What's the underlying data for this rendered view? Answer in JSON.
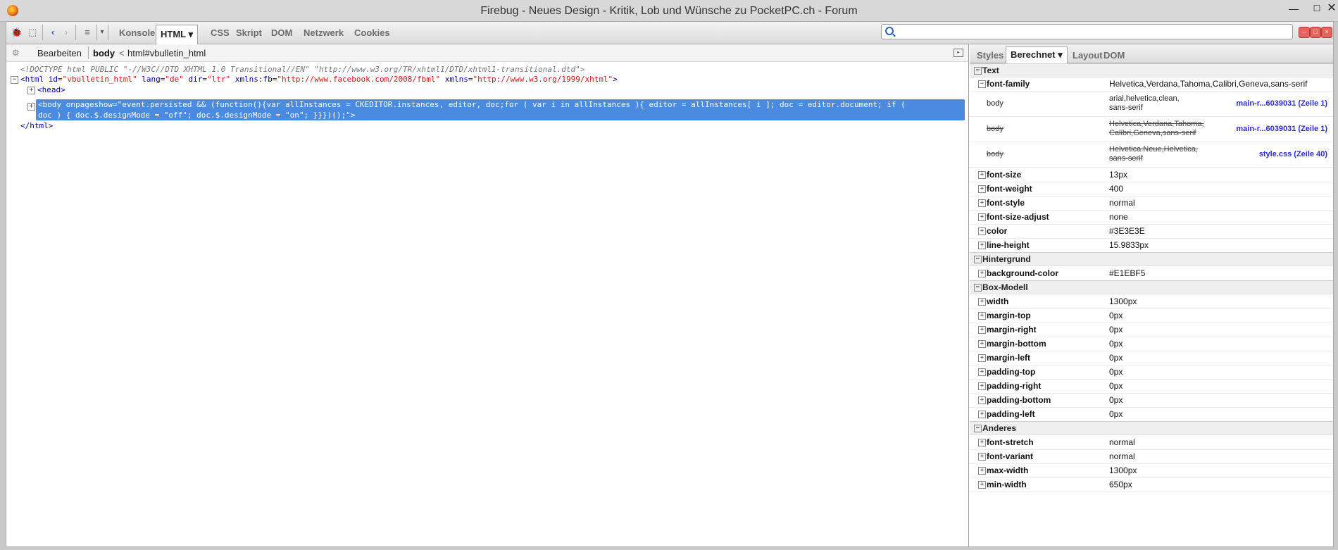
{
  "window": {
    "title": "Firebug - Neues Design - Kritik, Lob und Wünsche zu PocketPC.ch - Forum",
    "min_glyph": "—",
    "max_glyph": "☐",
    "close_glyph": "✕"
  },
  "toolbar": {
    "tabs": [
      "Konsole",
      "HTML",
      "CSS",
      "Skript",
      "DOM",
      "Netzwerk",
      "Cookies"
    ],
    "active_tab": "HTML",
    "dropdown_glyph": "▾",
    "search_placeholder": ""
  },
  "breadcrumb": {
    "edit": "Bearbeiten",
    "current": "body",
    "separator": "<",
    "parent": "html#vbulletin_html"
  },
  "html_tree": {
    "doctype": "<!DOCTYPE html PUBLIC \"-//W3C//DTD XHTML 1.0 Transitional//EN\" \"http://www.w3.org/TR/xhtml1/DTD/xhtml1-transitional.dtd\">",
    "html_open_start": "<html",
    "html_attrs": [
      {
        "name": "id",
        "value": "\"vbulletin_html\""
      },
      {
        "name": "lang",
        "value": "\"de\""
      },
      {
        "name": "dir",
        "value": "\"ltr\""
      },
      {
        "name": "xmlns:fb",
        "value": "\"http://www.facebook.com/2008/fbml\""
      },
      {
        "name": "xmlns",
        "value": "\"http://www.w3.org/1999/xhtml\""
      }
    ],
    "html_open_end": ">",
    "head": "<head>",
    "body_line1": "<body onpageshow=\"event.persisted && (function(){var allInstances = CKEDITOR.instances, editor, doc;for ( var i in allInstances ){ editor = allInstances[ i ]; doc = editor.document; if (",
    "body_line2": "doc ) { doc.$.designMode = \"off\"; doc.$.designMode = \"on\"; }}})();\">",
    "html_close": "</html>"
  },
  "side_tabs": [
    "Styles",
    "Berechnet",
    "Layout",
    "DOM"
  ],
  "side_active_tab": "Berechnet",
  "sections": {
    "text": "Text",
    "background": "Hintergrund",
    "box": "Box-Modell",
    "other": "Anderes"
  },
  "font_family": {
    "name": "font-family",
    "value": "Helvetica,Verdana,Tahoma,Calibri,Geneva,sans-serif",
    "rules": [
      {
        "selector": "body",
        "value_line1": "arial,helvetica,clean,",
        "value_line2": "sans-serif",
        "source": "main-r...6039031 (Zeile 1)"
      },
      {
        "selector": "body",
        "value_line1": "Helvetica,Verdana,Tahoma,",
        "value_line2": "Calibri,Geneva,sans-serif",
        "source": "main-r...6039031 (Zeile 1)"
      },
      {
        "selector": "body",
        "value_line1": "Helvetica Neue,Helvetica,",
        "value_line2": "sans-serif",
        "source": "style.css (Zeile 40)"
      }
    ]
  },
  "text_props": [
    {
      "name": "font-size",
      "value": "13px"
    },
    {
      "name": "font-weight",
      "value": "400"
    },
    {
      "name": "font-style",
      "value": "normal"
    },
    {
      "name": "font-size-adjust",
      "value": "none"
    },
    {
      "name": "color",
      "value": "#3E3E3E"
    },
    {
      "name": "line-height",
      "value": "15.9833px"
    }
  ],
  "bg_props": [
    {
      "name": "background-color",
      "value": "#E1EBF5"
    }
  ],
  "box_props": [
    {
      "name": "width",
      "value": "1300px"
    },
    {
      "name": "margin-top",
      "value": "0px"
    },
    {
      "name": "margin-right",
      "value": "0px"
    },
    {
      "name": "margin-bottom",
      "value": "0px"
    },
    {
      "name": "margin-left",
      "value": "0px"
    },
    {
      "name": "padding-top",
      "value": "0px"
    },
    {
      "name": "padding-right",
      "value": "0px"
    },
    {
      "name": "padding-bottom",
      "value": "0px"
    },
    {
      "name": "padding-left",
      "value": "0px"
    }
  ],
  "other_props": [
    {
      "name": "font-stretch",
      "value": "normal"
    },
    {
      "name": "font-variant",
      "value": "normal"
    },
    {
      "name": "max-width",
      "value": "1300px"
    },
    {
      "name": "min-width",
      "value": "650px"
    }
  ],
  "colors": {
    "selection": "#4a8be0",
    "source_link": "#2b2bd1",
    "tag": "#0000a6",
    "attr_value": "#c41a16"
  }
}
